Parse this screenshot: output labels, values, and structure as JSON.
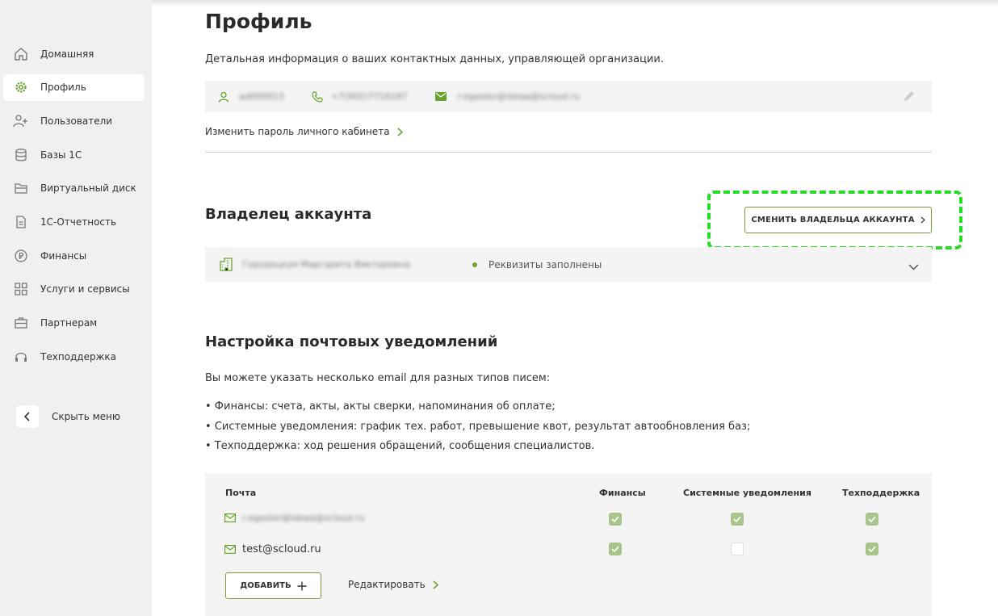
{
  "sidebar": {
    "items": [
      {
        "label": "Домашняя",
        "icon": "home-icon"
      },
      {
        "label": "Профиль",
        "icon": "gear-icon"
      },
      {
        "label": "Пользователи",
        "icon": "add-user-icon"
      },
      {
        "label": "Базы 1С",
        "icon": "database-icon"
      },
      {
        "label": "Виртуальный диск",
        "icon": "folder-icon"
      },
      {
        "label": "1С-Отчетность",
        "icon": "document-icon"
      },
      {
        "label": "Финансы",
        "icon": "ruble-icon"
      },
      {
        "label": "Услуги и сервисы",
        "icon": "grid-icon"
      },
      {
        "label": "Партнерам",
        "icon": "briefcase-icon"
      },
      {
        "label": "Техподдержка",
        "icon": "headset-icon"
      }
    ],
    "active_index": 1,
    "hide_menu_label": "Скрыть меню"
  },
  "profile": {
    "title": "Профиль",
    "subtitle": "Детальная информация о ваших контактных данных, управляющей организации.",
    "login_blurred": "ad000013",
    "phone_blurred": "+7(902)7716187",
    "email_blurred": "r.egaster@ideaa@scloud.ru",
    "change_password_label": "Изменить пароль личного кабинета"
  },
  "owner": {
    "title": "Владелец аккаунта",
    "change_owner_button": "СМЕНИТЬ ВЛАДЕЛЬЦА АККАУНТА",
    "name_blurred": "Городецкая Маргарита Викторовна",
    "status": "Реквизиты заполнены"
  },
  "notifications": {
    "title": "Настройка почтовых уведомлений",
    "description": "Вы можете указать несколько email для разных типов писем:",
    "bullets": [
      "• Финансы: счета, акты, акты сверки, напоминания об оплате;",
      "• Системные уведомления: график тех. работ, превышение квот, результат автообновления баз;",
      "• Техподдержка: ход решения обращений, сообщения специалистов."
    ],
    "table": {
      "headers": {
        "email": "Почта",
        "finance": "Финансы",
        "system": "Системные уведомления",
        "support": "Техподдержка"
      },
      "rows": [
        {
          "email": "r.egaster@ideaa@scloud.ru",
          "blurred": true,
          "finance": true,
          "system": true,
          "support": true
        },
        {
          "email": "test@scloud.ru",
          "blurred": false,
          "finance": true,
          "system": false,
          "support": true
        }
      ]
    },
    "add_button": "ДОБАВИТЬ",
    "edit_link": "Редактировать"
  },
  "colors": {
    "accent": "#6aa22e",
    "highlight": "#22dd22",
    "checkbox_on": "#a8c48a"
  }
}
